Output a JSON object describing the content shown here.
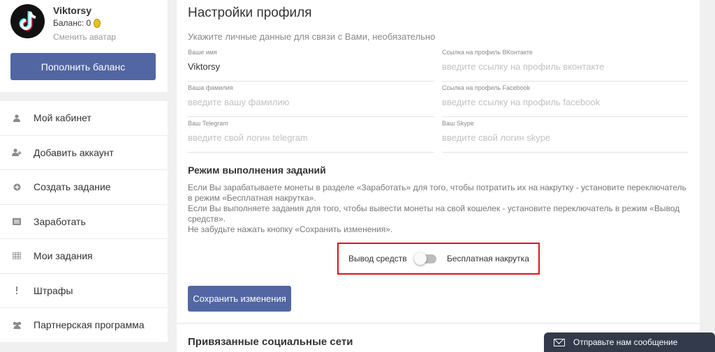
{
  "profile": {
    "username": "Viktorsy",
    "balance_label": "Баланс: 0",
    "change_avatar": "Сменить аватар",
    "topup_label": "Пополнить баланс"
  },
  "menu": {
    "items": [
      {
        "label": "Мой кабинет",
        "icon": "user-icon"
      },
      {
        "label": "Добавить аккаунт",
        "icon": "user-plus-icon"
      },
      {
        "label": "Создать задание",
        "icon": "plus-circle-icon"
      },
      {
        "label": "Заработать",
        "icon": "list-icon"
      },
      {
        "label": "Мои задания",
        "icon": "grid-icon"
      },
      {
        "label": "Штрафы",
        "icon": "exclamation-icon"
      },
      {
        "label": "Партнерская программа",
        "icon": "users-icon"
      }
    ]
  },
  "settings": {
    "title": "Настройки профиля",
    "subtitle": "Укажите личные данные для связи с Вами, необязательно",
    "fields": {
      "first_name": {
        "label": "Ваше имя",
        "value": "Viktorsy"
      },
      "vk": {
        "label": "Ссылка на профиль ВКонтакте",
        "placeholder": "введите ссылку на профиль вконтакте"
      },
      "last_name": {
        "label": "Ваша фамилия",
        "placeholder": "введите вашу фамилию"
      },
      "facebook": {
        "label": "Ссылка на профиль Facebook",
        "placeholder": "введите ссылку на профиль facebook"
      },
      "telegram": {
        "label": "Ваш Telegram",
        "placeholder": "введите свой логин telegram"
      },
      "skype": {
        "label": "Ваш Skype",
        "placeholder": "введите свой логин skype"
      }
    },
    "mode_title": "Режим выполнения заданий",
    "mode_desc_1": "Если Вы зарабатываете монеты в разделе «Заработать» для того, чтобы потратить их на накрутку - установите переключатель в режим «Бесплатная накрутка».",
    "mode_desc_2": "Если Вы выполняете задания для того, чтобы вывести монеты на свой кошелек - установите переключатель в режим «Вывод средств».",
    "mode_desc_3": "Не забудьте нажать кнопку «Сохранить изменения».",
    "toggle_left": "Вывод средств",
    "toggle_right": "Бесплатная накрутка",
    "toggle_state": "Вывод средств",
    "save_label": "Сохранить изменения"
  },
  "social": {
    "title": "Привязанные социальные сети"
  },
  "chat": {
    "label": "Отправьте нам сообщение"
  },
  "colors": {
    "accent": "#5166a3",
    "highlight_border": "#e0121b",
    "chat_bg": "#323a4b"
  }
}
